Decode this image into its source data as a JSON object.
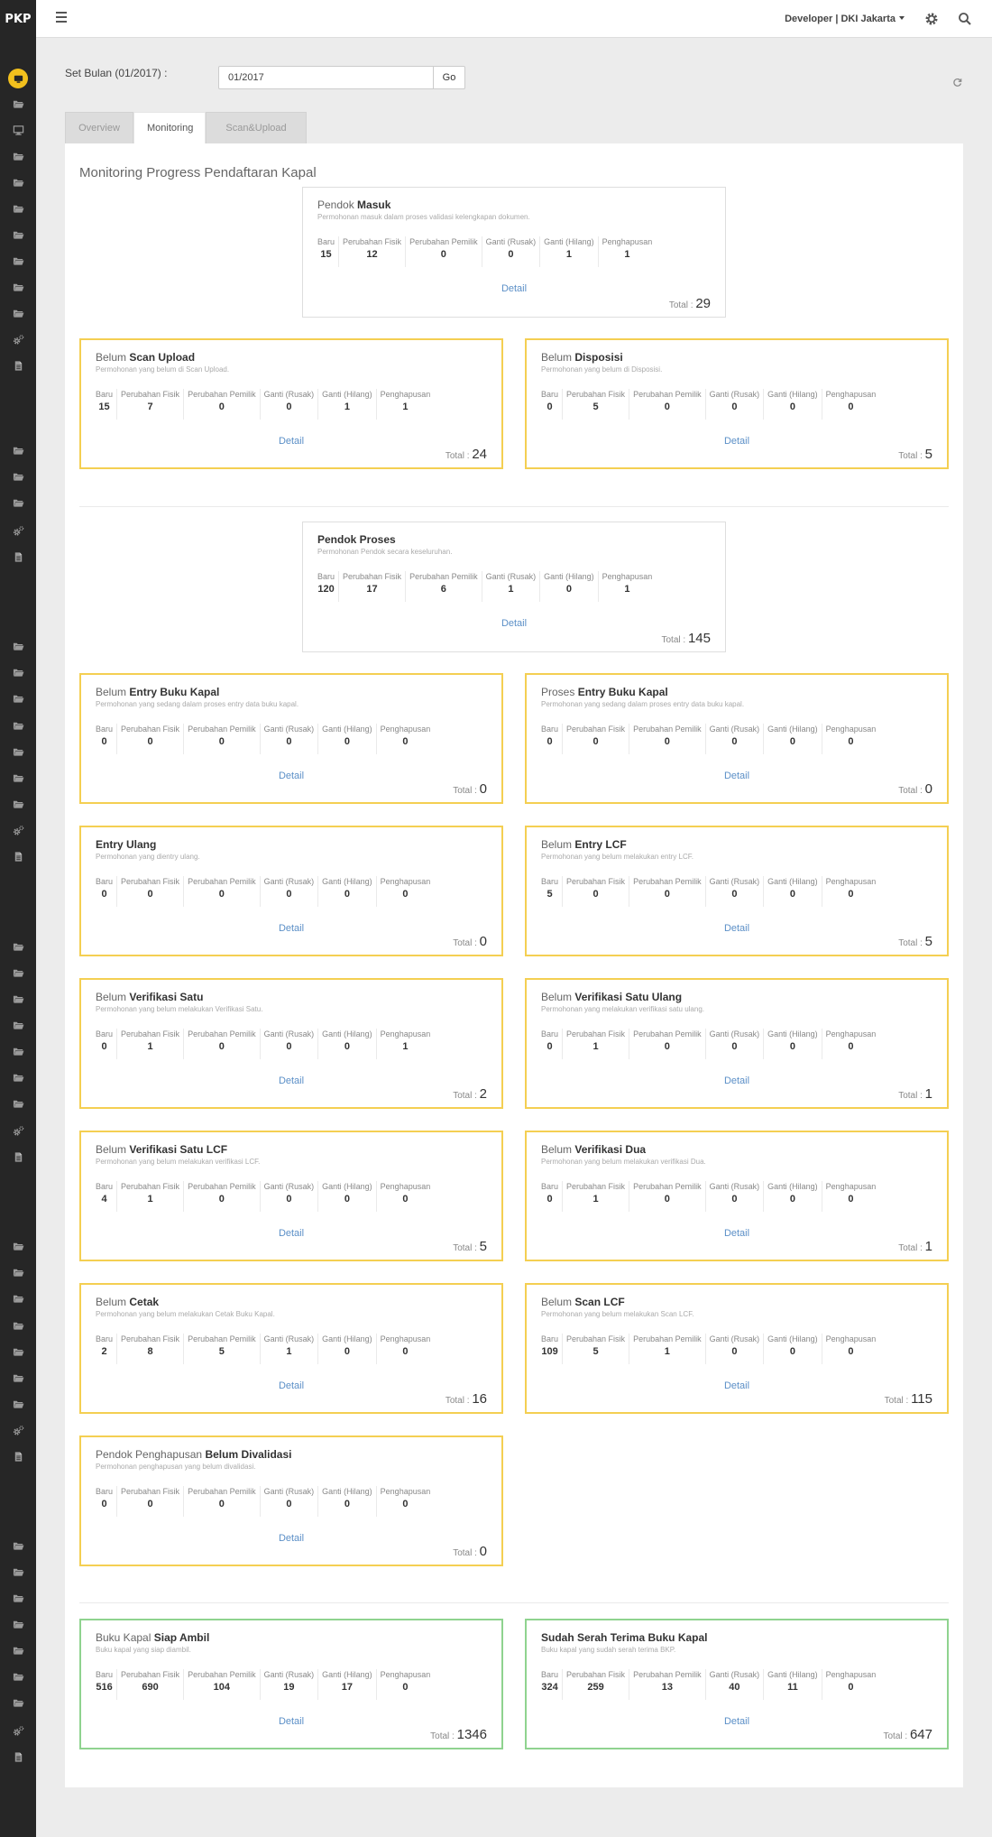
{
  "app": {
    "logo": "PKP"
  },
  "header": {
    "user": "Developer | DKI Jakarta"
  },
  "filter": {
    "label": "Set Bulan (01/2017) :",
    "value": "01/2017",
    "go_label": "Go"
  },
  "tabs": [
    {
      "label": "Overview"
    },
    {
      "label": "Monitoring"
    },
    {
      "label": "Scan&Upload"
    }
  ],
  "panel": {
    "title": "Monitoring Progress Pendaftaran Kapal"
  },
  "labels": {
    "columns": [
      "Baru",
      "Perubahan Fisik",
      "Perubahan Pemilik",
      "Ganti (Rusak)",
      "Ganti (Hilang)",
      "Penghapusan"
    ],
    "detail": "Detail",
    "total": "Total :"
  },
  "cards": [
    {
      "prefix": "Pendok",
      "bold": "Masuk",
      "sub": "Permohonan masuk dalam proses validasi kelengkapan dokumen.",
      "values": [
        "15",
        "12",
        "0",
        "0",
        "1",
        "1"
      ],
      "total": "29"
    },
    {
      "prefix": "Belum",
      "bold": "Scan Upload",
      "sub": "Permohonan yang belum di Scan Upload.",
      "values": [
        "15",
        "7",
        "0",
        "0",
        "1",
        "1"
      ],
      "total": "24"
    },
    {
      "prefix": "Belum",
      "bold": "Disposisi",
      "sub": "Permohonan yang belum di Disposisi.",
      "values": [
        "0",
        "5",
        "0",
        "0",
        "0",
        "0"
      ],
      "total": "5"
    },
    {
      "prefix": "",
      "bold": "Pendok Proses",
      "sub": "Permohonan Pendok secara keseluruhan.",
      "values": [
        "120",
        "17",
        "6",
        "1",
        "0",
        "1"
      ],
      "total": "145"
    },
    {
      "prefix": "Belum",
      "bold": "Entry Buku Kapal",
      "sub": "Permohonan yang sedang dalam proses entry data buku kapal.",
      "values": [
        "0",
        "0",
        "0",
        "0",
        "0",
        "0"
      ],
      "total": "0"
    },
    {
      "prefix": "Proses",
      "bold": "Entry Buku Kapal",
      "sub": "Permohonan yang sedang dalam proses entry data buku kapal.",
      "values": [
        "0",
        "0",
        "0",
        "0",
        "0",
        "0"
      ],
      "total": "0"
    },
    {
      "prefix": "",
      "bold": "Entry Ulang",
      "sub": "Permohonan yang dientry ulang.",
      "values": [
        "0",
        "0",
        "0",
        "0",
        "0",
        "0"
      ],
      "total": "0"
    },
    {
      "prefix": "Belum",
      "bold": "Entry LCF",
      "sub": "Permohonan yang belum melakukan entry LCF.",
      "values": [
        "5",
        "0",
        "0",
        "0",
        "0",
        "0"
      ],
      "total": "5"
    },
    {
      "prefix": "Belum",
      "bold": "Verifikasi Satu",
      "sub": "Permohonan yang belum melakukan Verifikasi Satu.",
      "values": [
        "0",
        "1",
        "0",
        "0",
        "0",
        "1"
      ],
      "total": "2"
    },
    {
      "prefix": "Belum",
      "bold": "Verifikasi Satu Ulang",
      "sub": "Permohonan yang melakukan verifikasi satu ulang.",
      "values": [
        "0",
        "1",
        "0",
        "0",
        "0",
        "0"
      ],
      "total": "1"
    },
    {
      "prefix": "Belum",
      "bold": "Verifikasi Satu LCF",
      "sub": "Permohonan yang belum melakukan verifikasi LCF.",
      "values": [
        "4",
        "1",
        "0",
        "0",
        "0",
        "0"
      ],
      "total": "5"
    },
    {
      "prefix": "Belum",
      "bold": "Verifikasi Dua",
      "sub": "Permohonan yang belum melakukan verifikasi Dua.",
      "values": [
        "0",
        "1",
        "0",
        "0",
        "0",
        "0"
      ],
      "total": "1"
    },
    {
      "prefix": "Belum",
      "bold": "Cetak",
      "sub": "Permohonan yang belum melakukan Cetak Buku Kapal.",
      "values": [
        "2",
        "8",
        "5",
        "1",
        "0",
        "0"
      ],
      "total": "16"
    },
    {
      "prefix": "Belum",
      "bold": "Scan LCF",
      "sub": "Permohonan yang belum melakukan Scan LCF.",
      "values": [
        "109",
        "5",
        "1",
        "0",
        "0",
        "0"
      ],
      "total": "115"
    },
    {
      "prefix": "Pendok Penghapusan",
      "bold": "Belum Divalidasi",
      "sub": "Permohonan penghapusan yang belum divalidasi.",
      "values": [
        "0",
        "0",
        "0",
        "0",
        "0",
        "0"
      ],
      "total": "0"
    },
    {
      "prefix": "Buku Kapal",
      "bold": "Siap Ambil",
      "sub": "Buku kapal yang siap diambil.",
      "values": [
        "516",
        "690",
        "104",
        "19",
        "17",
        "0"
      ],
      "total": "1346"
    },
    {
      "prefix": "",
      "bold": "Sudah Serah Terima Buku Kapal",
      "sub": "Buku kapal yang sudah serah terima BKP.",
      "values": [
        "324",
        "259",
        "13",
        "40",
        "11",
        "0"
      ],
      "total": "647"
    }
  ],
  "icons": {
    "active_menu": "monitor-icon",
    "folder": "folder-icon",
    "desktop": "desktop-icon",
    "cogs": "cogs-icon",
    "file": "file-icon"
  },
  "colors": {
    "sidebar": "#262626",
    "accent_yellow": "#f4cf52",
    "accent_green": "#8fd38f",
    "link": "#5b8fc7",
    "active_icon": "#f2c01d"
  }
}
